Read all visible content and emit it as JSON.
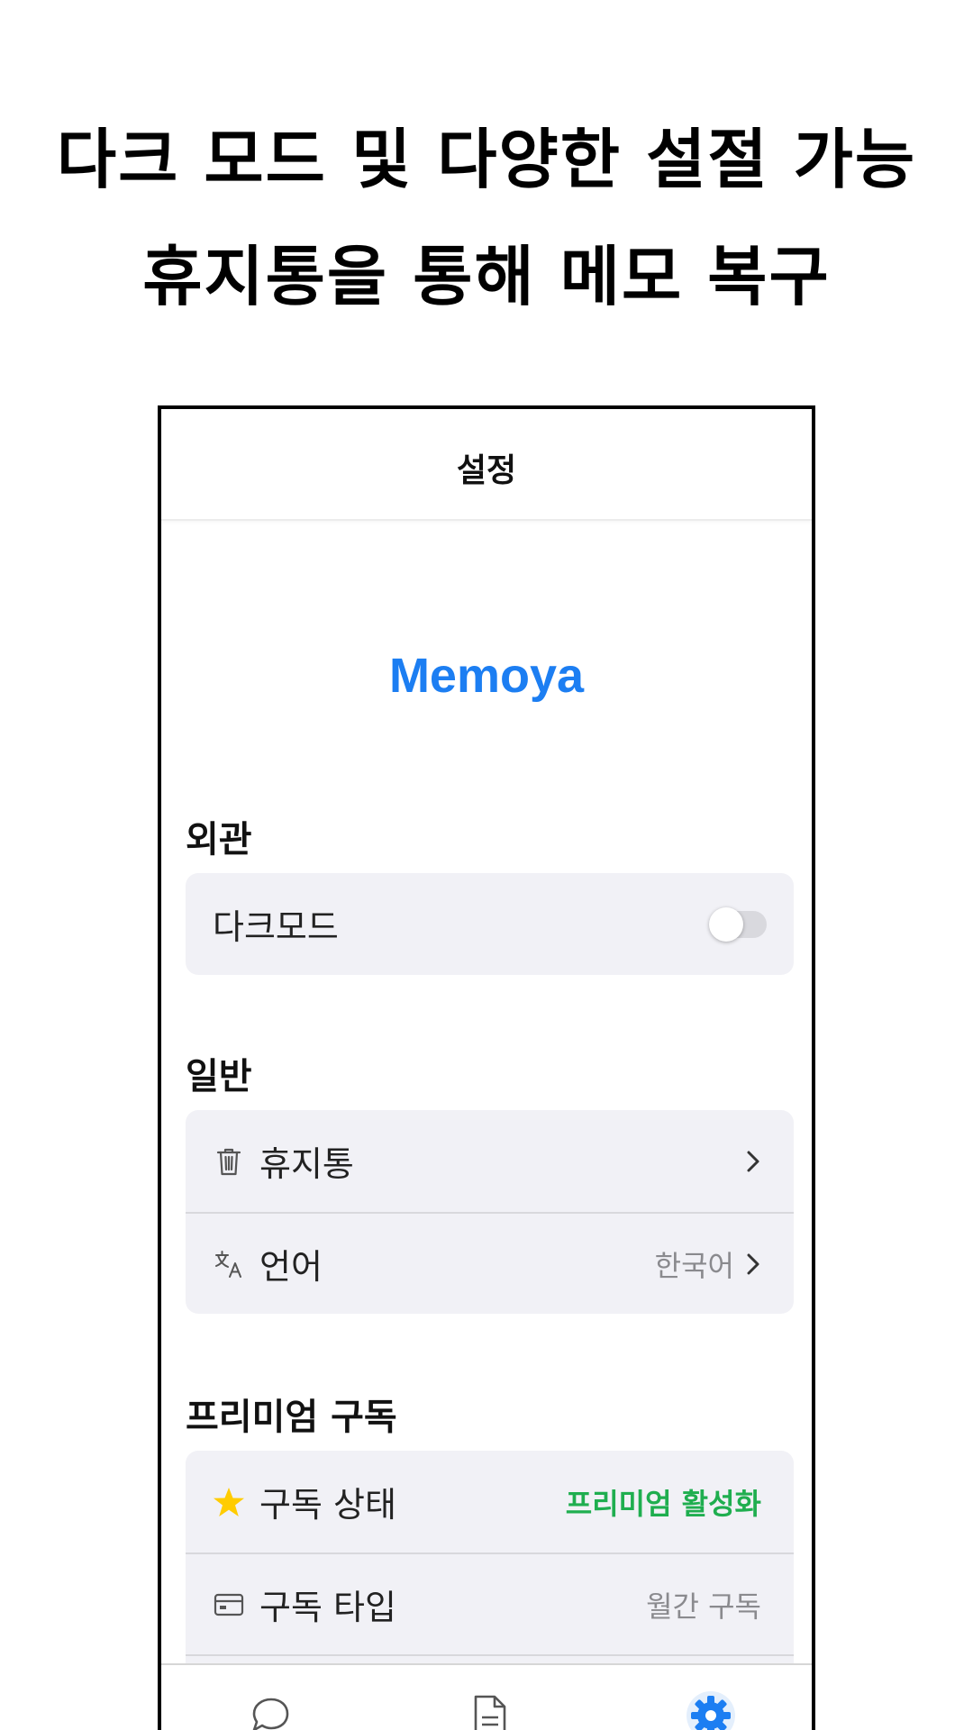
{
  "promo": {
    "line1": "다크 모드 및 다양한 설절 가능",
    "line2": "휴지통을 통해 메모 복구"
  },
  "header": {
    "title": "설정"
  },
  "app_name": "Memoya",
  "appearance": {
    "title": "외관",
    "dark_mode_label": "다크모드",
    "dark_mode_on": false
  },
  "general": {
    "title": "일반",
    "trash_label": "휴지통",
    "language_label": "언어",
    "language_value": "한국어"
  },
  "premium": {
    "title": "프리미엄 구독",
    "status_label": "구독 상태",
    "status_value": "프리미엄 활성화",
    "type_label": "구독 타입",
    "type_value": "월간 구독"
  },
  "colors": {
    "accent": "#1c7ef2",
    "premium_active": "#1fae4f",
    "star": "#ffcc00"
  },
  "tabbar": {
    "tabs": [
      {
        "icon": "chat-bubble-icon",
        "active": false
      },
      {
        "icon": "document-icon",
        "active": false
      },
      {
        "icon": "gear-icon",
        "active": true
      }
    ]
  }
}
